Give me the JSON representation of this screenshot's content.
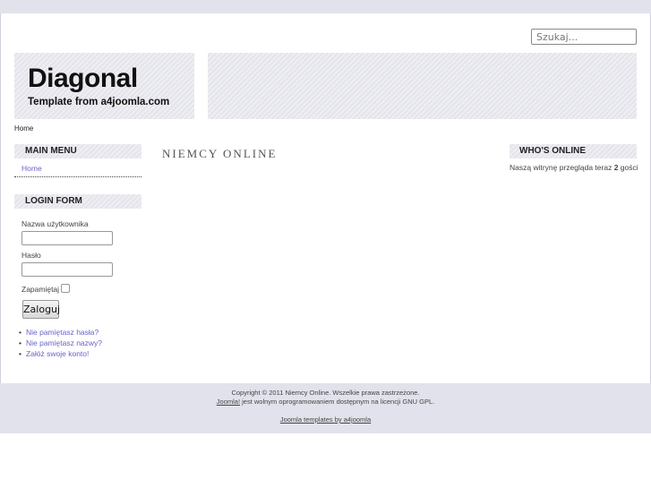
{
  "search": {
    "placeholder": "Szukaj..."
  },
  "logo": {
    "title": "Diagonal",
    "subtitle": "Template from a4joomla.com"
  },
  "breadcrumb": "Home",
  "main_menu": {
    "heading": "MAIN MENU",
    "items": [
      "Home"
    ]
  },
  "login": {
    "heading": "LOGIN FORM",
    "username_label": "Nazwa użytkownika",
    "password_label": "Hasło",
    "remember_label": "Zapamiętaj",
    "submit": "Zaloguj",
    "links": [
      "Nie pamiętasz hasła?",
      "Nie pamiętasz nazwy?",
      "Załóż swoje konto!"
    ]
  },
  "content": {
    "title": "NIEMCY ONLINE"
  },
  "whos_online": {
    "heading": "WHO'S ONLINE",
    "text_before": "Naszą witrynę przegląda teraz ",
    "count": "2",
    "text_after": " gości"
  },
  "footer": {
    "copyright": "Copyright © 2011 Niemcy Online. Wszelkie prawa zastrzeżone.",
    "joomla_link": "Joomla!",
    "license_text": " jest wolnym oprogramowaniem dostępnym na licencji GNU GPL.",
    "templates_link": "Joomla templates by a4joomla"
  }
}
